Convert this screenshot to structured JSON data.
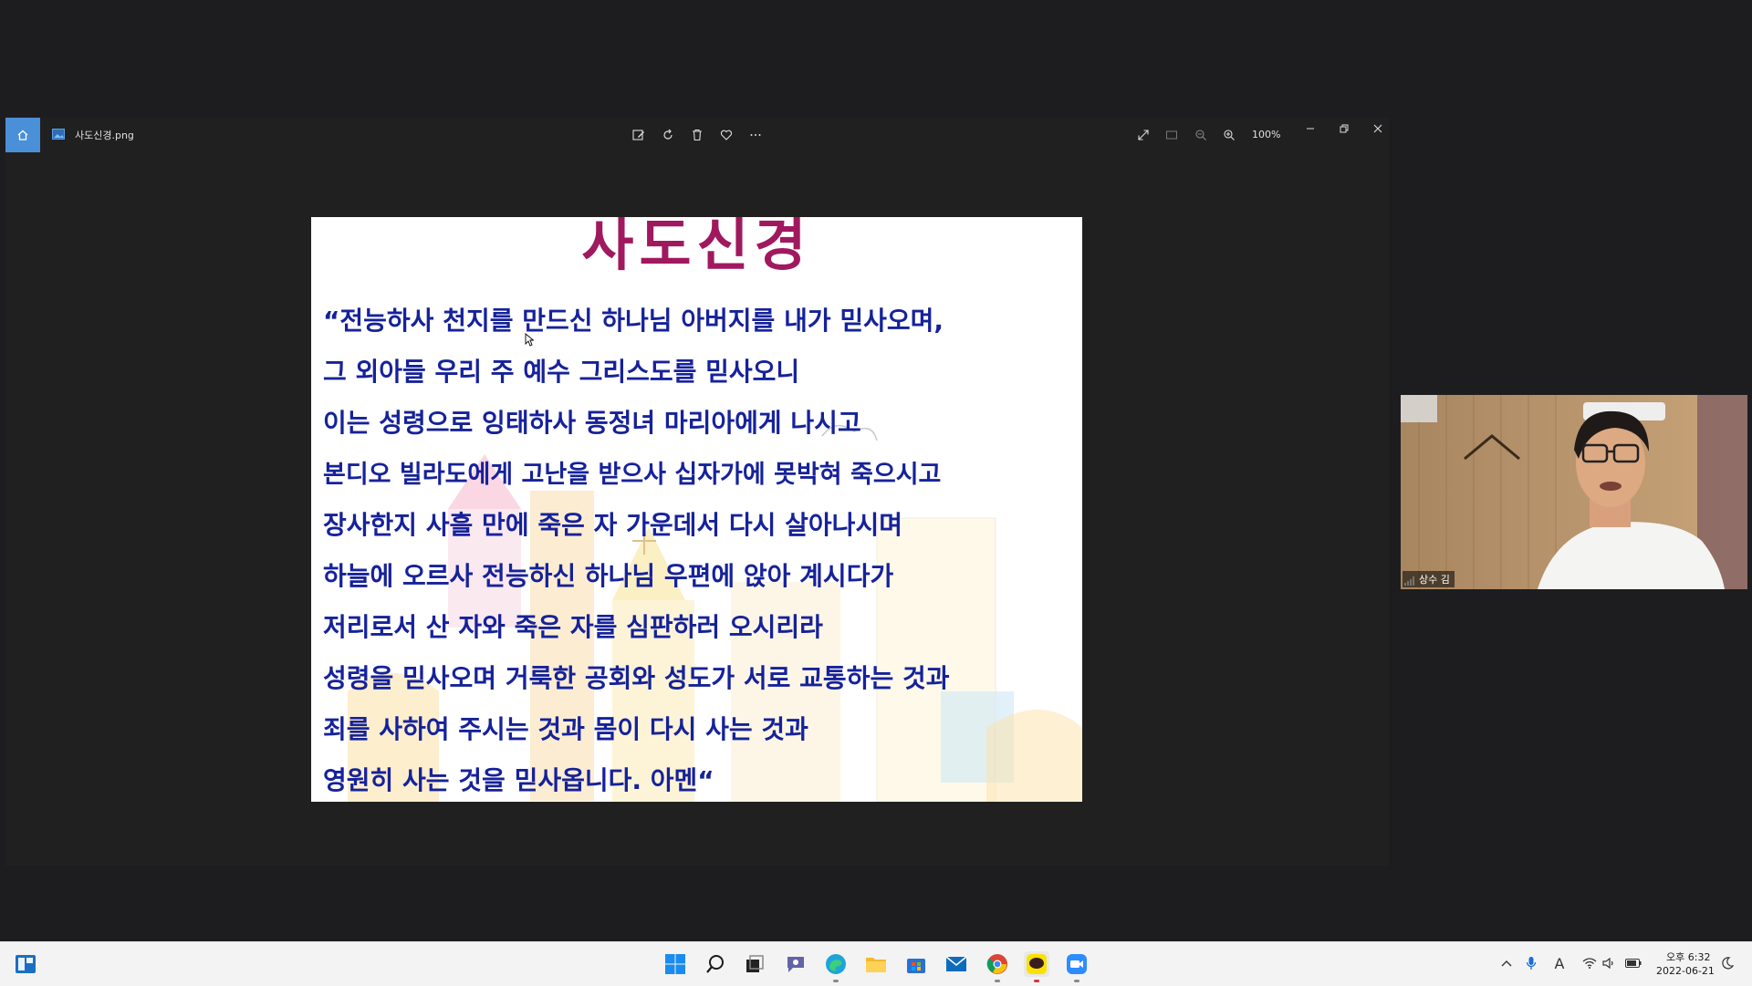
{
  "viewer": {
    "file_name": "사도신경.png",
    "zoom_label": "100%"
  },
  "slide": {
    "title": "사도신경",
    "lines": [
      "“전능하사 천지를 만드신 하나님 아버지를 내가 믿사오며,",
      "그 외아들 우리 주 예수 그리스도를 믿사오니",
      "이는 성령으로 잉태하사 동정녀 마리아에게 나시고",
      "본디오 빌라도에게 고난을 받으사 십자가에 못박혀 죽으시고",
      "장사한지 사흘 만에 죽은 자 가운데서 다시 살아나시며",
      "하늘에 오르사 전능하신 하나님 우편에 앉아 계시다가",
      "저리로서 산 자와 죽은 자를 심판하러 오시리라",
      "성령을 믿사오며 거룩한 공회와 성도가 서로 교통하는 것과",
      "죄를 사하여 주시는 것과 몸이 다시 사는 것과",
      "영원히 사는 것을 믿사옵니다. 아멘“"
    ]
  },
  "participant": {
    "name": "상수 김"
  },
  "taskbar": {
    "clock_time": "오후 6:32",
    "clock_date": "2022-06-21",
    "ime_label": "A"
  },
  "colors": {
    "slide_title": "#a0195e",
    "slide_text": "#16229a",
    "home_accent": "#4a90d9"
  }
}
